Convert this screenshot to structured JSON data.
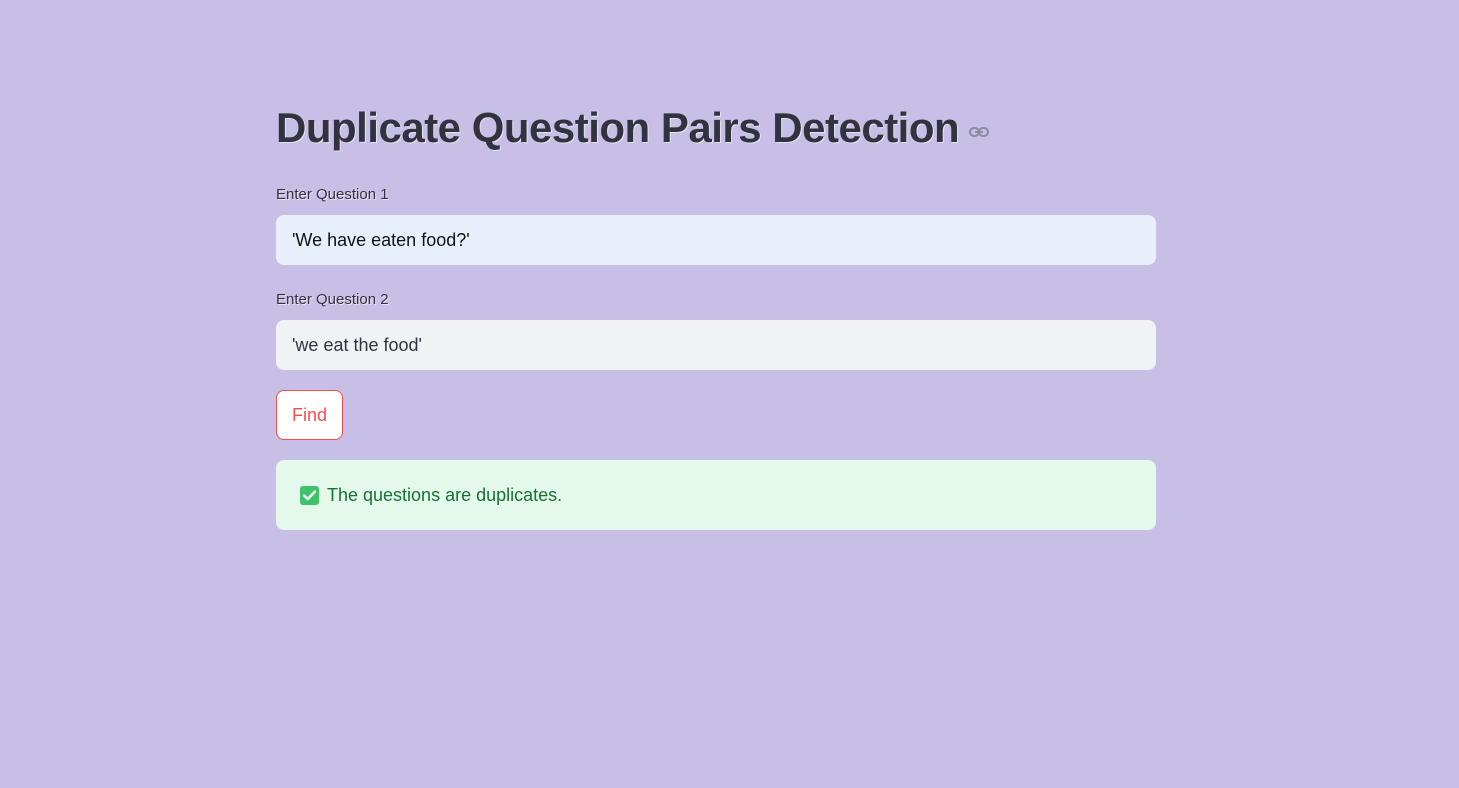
{
  "page": {
    "title": "Duplicate Question Pairs Detection",
    "title_link_icon": "link-icon"
  },
  "form": {
    "question1": {
      "label": "Enter Question 1",
      "value": "'We have eaten food?'"
    },
    "question2": {
      "label": "Enter Question 2",
      "value": "'we eat the food'"
    },
    "find_label": "Find"
  },
  "result": {
    "icon": "check-icon",
    "message": "The questions are duplicates."
  },
  "colors": {
    "background": "#c7bfe6",
    "primary": "#ff4b4b",
    "success_bg": "#e4f8ec",
    "success_text": "#177233"
  }
}
